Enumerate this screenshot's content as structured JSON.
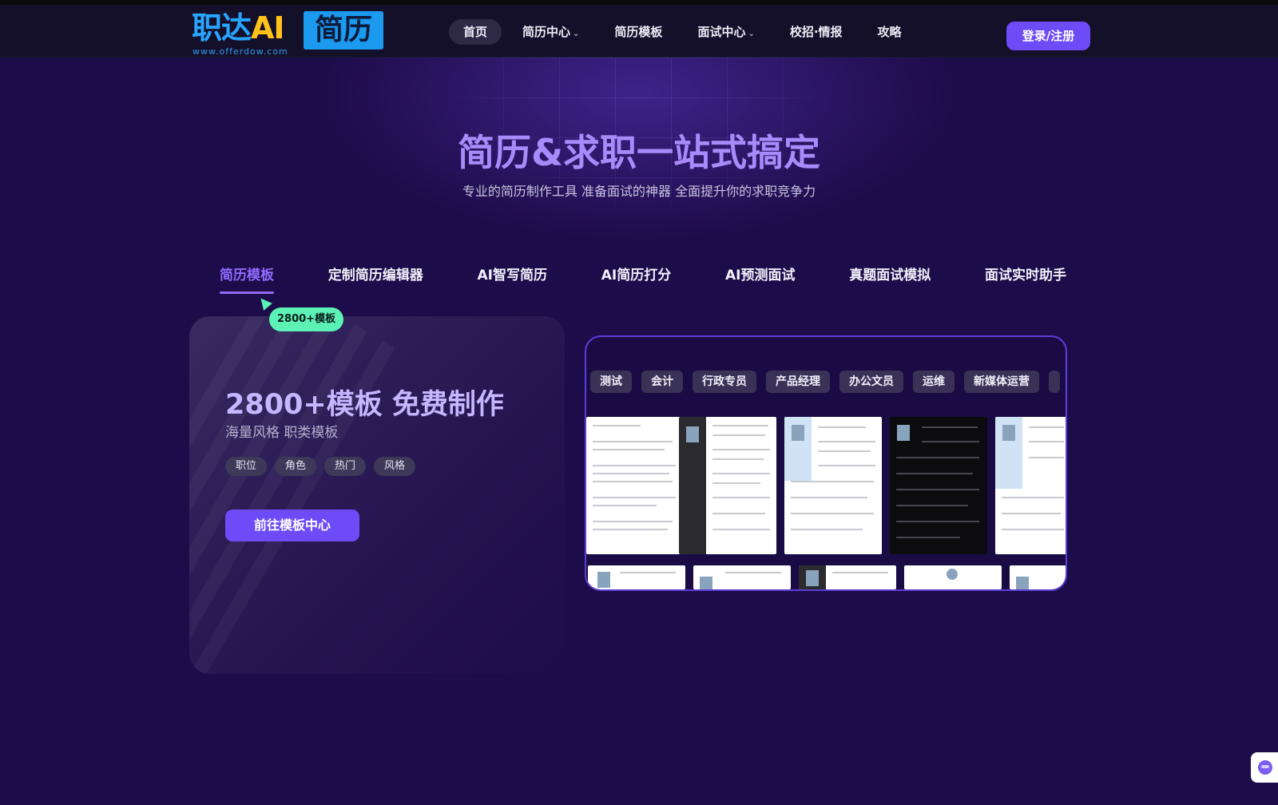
{
  "header": {
    "logo": {
      "main_prefix": "职达",
      "main_ai": "AI",
      "box_text": "简历",
      "url": "www.offerdow.com"
    },
    "nav": [
      {
        "label": "首页",
        "active": true,
        "has_caret": false
      },
      {
        "label": "简历中心",
        "active": false,
        "has_caret": true
      },
      {
        "label": "简历模板",
        "active": false,
        "has_caret": false
      },
      {
        "label": "面试中心",
        "active": false,
        "has_caret": true
      },
      {
        "label": "校招·情报",
        "active": false,
        "has_caret": false
      },
      {
        "label": "攻略",
        "active": false,
        "has_caret": false
      }
    ],
    "login_label": "登录/注册"
  },
  "hero": {
    "title": "简历&求职一站式搞定",
    "subtitle": "专业的简历制作工具 准备面试的神器 全面提升你的求职竞争力"
  },
  "feature_tabs": [
    {
      "label": "简历模板",
      "active": true
    },
    {
      "label": "定制简历编辑器",
      "active": false
    },
    {
      "label": "AI智写简历",
      "active": false
    },
    {
      "label": "AI简历打分",
      "active": false
    },
    {
      "label": "AI预测面试",
      "active": false
    },
    {
      "label": "真题面试模拟",
      "active": false
    },
    {
      "label": "面试实时助手",
      "active": false
    }
  ],
  "card": {
    "badge": "2800+模板",
    "title": "2800+模板 免费制作",
    "subtitle": "海量风格 职类模板",
    "chips": [
      "职位",
      "角色",
      "热门",
      "风格"
    ],
    "cta": "前往模板中心"
  },
  "gallery": {
    "categories": [
      "测试",
      "会计",
      "行政专员",
      "产品经理",
      "办公文员",
      "运维",
      "新媒体运营"
    ]
  },
  "colors": {
    "accent": "#6d4bf7",
    "badge": "#5cf2b5",
    "title": "#a78bfa",
    "bg": "#1d0c4a"
  },
  "icons": {
    "chat": "chat-assistant-icon",
    "cursor": "cursor-arrow-icon"
  }
}
